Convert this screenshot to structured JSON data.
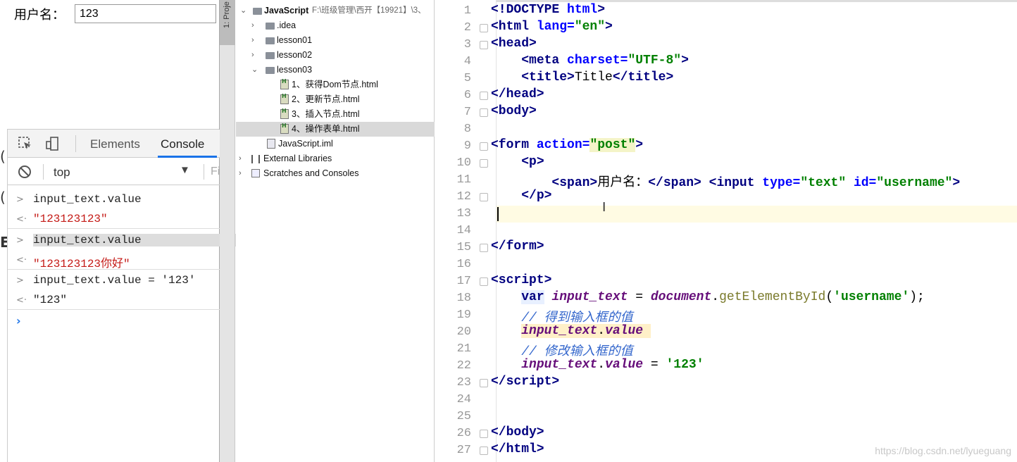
{
  "preview": {
    "label": "用户名：",
    "input_value": "123"
  },
  "devtools": {
    "tabs": [
      "Elements",
      "Console"
    ],
    "context": "top",
    "filter_placeholder": "Fi",
    "entries": [
      {
        "type": "input",
        "text": "input_text.value"
      },
      {
        "type": "output",
        "text": "\"123123123\""
      },
      {
        "type": "input",
        "text": "input_text.value"
      },
      {
        "type": "output",
        "text": "\"123123123你好\""
      },
      {
        "type": "input",
        "text": "input_text.value = '123'"
      },
      {
        "type": "output",
        "text": "\"123\""
      }
    ]
  },
  "strip": {
    "label": "1: Proje"
  },
  "tree": {
    "root": "JavaScript",
    "root_path": "F:\\班级管理\\西开【19921】\\3、",
    "items": [
      ".idea",
      "lesson01",
      "lesson02",
      "lesson03",
      "1、获得Dom节点.html",
      "2、更新节点.html",
      "3、插入节点.html",
      "4、操作表单.html",
      "JavaScript.iml",
      "External Libraries",
      "Scratches and Consoles"
    ]
  },
  "editor": {
    "line_numbers": [
      "1",
      "2",
      "3",
      "4",
      "5",
      "6",
      "7",
      "8",
      "9",
      "10",
      "11",
      "12",
      "13",
      "14",
      "15",
      "16",
      "17",
      "18",
      "19",
      "20",
      "21",
      "22",
      "23",
      "24",
      "25",
      "26",
      "27"
    ],
    "watermark": "https://blog.csdn.net/lyueguang"
  }
}
